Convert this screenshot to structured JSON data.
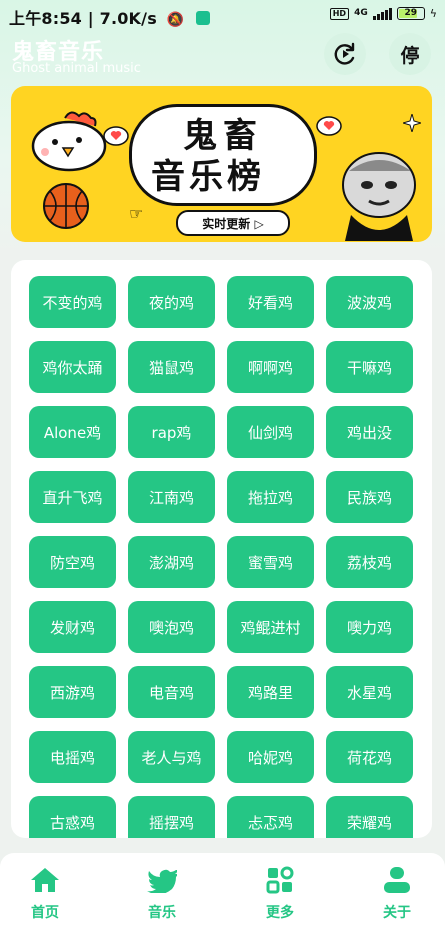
{
  "status_bar": {
    "time": "上午8:54",
    "speed": "7.0K/s",
    "hd": "HD",
    "network": "4G",
    "battery": "29"
  },
  "header": {
    "title": "鬼畜音乐",
    "subtitle": "Ghost animal music",
    "stop_label": "停"
  },
  "banner": {
    "line1": "鬼畜",
    "line2": "音乐榜",
    "badge": "实时更新 ▷"
  },
  "songs": [
    "不变的鸡",
    "夜的鸡",
    "好看鸡",
    "波波鸡",
    "鸡你太踊",
    "猫鼠鸡",
    "啊啊鸡",
    "干嘛鸡",
    "Alone鸡",
    "rap鸡",
    "仙剑鸡",
    "鸡出没",
    "直升飞鸡",
    "江南鸡",
    "拖拉鸡",
    "民族鸡",
    "防空鸡",
    "澎湖鸡",
    "蜜雪鸡",
    "荔枝鸡",
    "发财鸡",
    "噢泡鸡",
    "鸡鲲进村",
    "噢力鸡",
    "西游鸡",
    "电音鸡",
    "鸡路里",
    "水星鸡",
    "电摇鸡",
    "老人与鸡",
    "哈妮鸡",
    "荷花鸡",
    "古惑鸡",
    "摇摆鸡",
    "忐忑鸡",
    "荣耀鸡"
  ],
  "nav": [
    {
      "label": "首页",
      "icon": "home-icon"
    },
    {
      "label": "音乐",
      "icon": "bird-icon"
    },
    {
      "label": "更多",
      "icon": "apps-icon"
    },
    {
      "label": "关于",
      "icon": "user-icon"
    }
  ],
  "colors": {
    "accent": "#25c685",
    "banner_bg": "#ffd422"
  }
}
